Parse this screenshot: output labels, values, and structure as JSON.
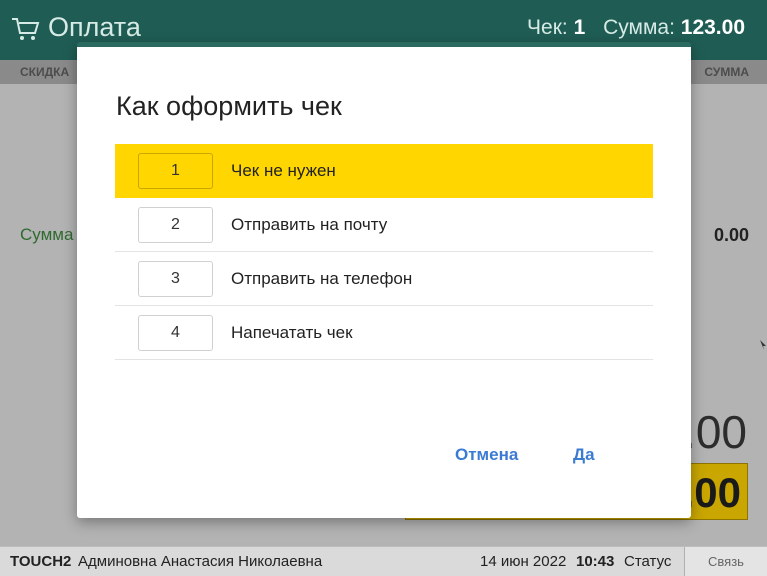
{
  "header": {
    "title": "Оплата",
    "check_label": "Чек:",
    "check_number": "1",
    "sum_label": "Сумма:",
    "sum_value": "123.00"
  },
  "subheader": {
    "left": "СКИДКА",
    "right": "СУММА"
  },
  "summary_row": {
    "label": "Сумма",
    "value": "0.00"
  },
  "totals": {
    "big_visible": ".00",
    "highlight_visible": ".00"
  },
  "dialog": {
    "title": "Как оформить чек",
    "options": [
      {
        "key": "1",
        "label": "Чек не нужен",
        "selected": true
      },
      {
        "key": "2",
        "label": "Отправить на почту"
      },
      {
        "key": "3",
        "label": "Отправить на телефон"
      },
      {
        "key": "4",
        "label": "Напечатать чек"
      }
    ],
    "cancel_label": "Отмена",
    "ok_label": "Да"
  },
  "statusbar": {
    "device": "TOUCH2",
    "user": "Админовна Анастасия Николаевна",
    "date": "14 июн 2022",
    "time": "10:43",
    "status": "Статус",
    "link": "Связь"
  },
  "colors": {
    "header_bg": "#1f5d54",
    "selected_bg": "#ffd600",
    "accent_link": "#3b7bd3"
  },
  "icons": {
    "cart": "shopping-cart-icon"
  }
}
